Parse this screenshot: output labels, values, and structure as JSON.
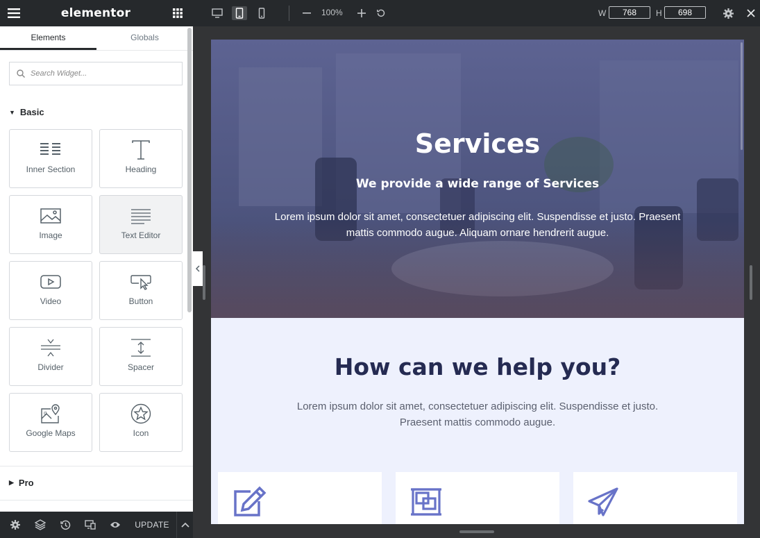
{
  "panel": {
    "logo": "elementor",
    "tabs": [
      {
        "label": "Elements"
      },
      {
        "label": "Globals"
      }
    ],
    "search_placeholder": "Search Widget...",
    "categories": {
      "basic": "Basic",
      "pro": "Pro"
    },
    "widgets": [
      {
        "label": "Inner Section",
        "icon": "inner-section-icon"
      },
      {
        "label": "Heading",
        "icon": "heading-icon"
      },
      {
        "label": "Image",
        "icon": "image-icon"
      },
      {
        "label": "Text Editor",
        "icon": "text-editor-icon"
      },
      {
        "label": "Video",
        "icon": "video-icon"
      },
      {
        "label": "Button",
        "icon": "button-icon"
      },
      {
        "label": "Divider",
        "icon": "divider-icon"
      },
      {
        "label": "Spacer",
        "icon": "spacer-icon"
      },
      {
        "label": "Google Maps",
        "icon": "google-maps-icon"
      },
      {
        "label": "Icon",
        "icon": "star-icon"
      }
    ],
    "footer": {
      "update_label": "UPDATE"
    }
  },
  "toolbar": {
    "zoom": "100%",
    "width_label": "W",
    "width_value": "768",
    "height_label": "H",
    "height_value": "698"
  },
  "page": {
    "hero": {
      "title": "Services",
      "subtitle": "We provide a wide range of Services",
      "text": "Lorem ipsum dolor sit amet, consectetuer adipiscing elit. Suspendisse et justo. Praesent mattis commodo augue. Aliquam ornare hendrerit augue."
    },
    "help": {
      "title": "How can we help you?",
      "text": "Lorem ipsum dolor sit amet, consectetuer adipiscing elit. Suspendisse et justo. Praesent mattis commodo augue."
    },
    "cards": [
      {
        "icon": "edit-icon"
      },
      {
        "icon": "frame-icon"
      },
      {
        "icon": "paper-plane-icon"
      }
    ]
  },
  "colors": {
    "accent": "#6873c8",
    "heading": "#252b52",
    "section_bg": "#eef1fd",
    "panel_dark": "#26292c"
  }
}
